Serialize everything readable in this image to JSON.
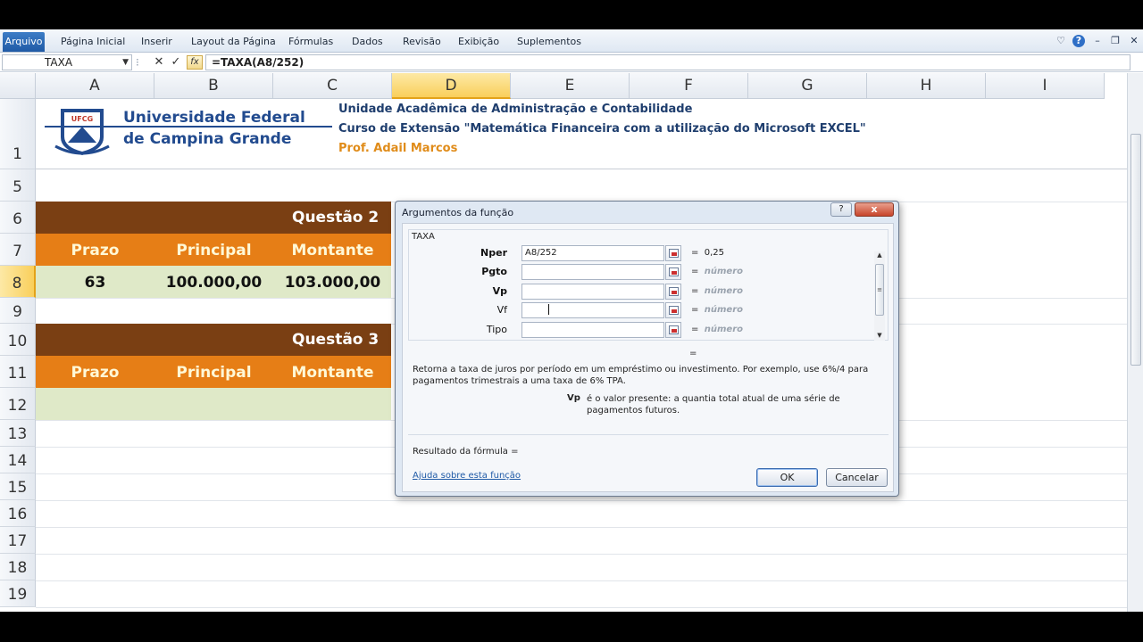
{
  "ribbon": {
    "file_tab": "Arquivo",
    "tabs": [
      "Página Inicial",
      "Inserir",
      "Layout da Página",
      "Fórmulas",
      "Dados",
      "Revisão",
      "Exibição",
      "Suplementos"
    ]
  },
  "formula_bar": {
    "name_box": "TAXA",
    "fx_label": "fx",
    "formula": "=TAXA(A8/252)"
  },
  "columns": [
    "A",
    "B",
    "C",
    "D",
    "E",
    "F",
    "G",
    "H",
    "I"
  ],
  "rows": [
    "1",
    "5",
    "6",
    "7",
    "8",
    "9",
    "10",
    "11",
    "12",
    "13",
    "14",
    "15",
    "16",
    "17",
    "18",
    "19"
  ],
  "banner": {
    "logo_text": "UFCG",
    "university_line1": "Universidade Federal",
    "university_line2": "de Campina Grande",
    "institute_line1": "Unidade Acadêmica de Administração e Contabilidade",
    "institute_line2": "Curso de Extensão \"Matemática Financeira com a utilização do Microsoft EXCEL\"",
    "institute_line3": "Prof. Adail Marcos"
  },
  "question2": {
    "title": "Questão 2",
    "headers": [
      "Prazo",
      "Principal",
      "Montante"
    ],
    "values": [
      "63",
      "100.000,00",
      "103.000,00"
    ]
  },
  "question3": {
    "title": "Questão 3",
    "headers": [
      "Prazo",
      "Principal",
      "Montante"
    ]
  },
  "dialog": {
    "title": "Argumentos da função",
    "help_label": "?",
    "close_label": "x",
    "function_name": "TAXA",
    "args": [
      {
        "label": "Nper",
        "value": "A8/252",
        "result": "0,25"
      },
      {
        "label": "Pgto",
        "value": "",
        "result": "número"
      },
      {
        "label": "Vp",
        "value": "",
        "result": "número"
      },
      {
        "label": "Vf",
        "value": "",
        "result": "número"
      },
      {
        "label": "Tipo",
        "value": "",
        "result": "número"
      }
    ],
    "equals": "=",
    "description": "Retorna a taxa de juros por período em um empréstimo ou investimento. Por exemplo, use 6%/4 para pagamentos trimestrais a uma taxa de 6% TPA.",
    "arg_desc_name": "Vp",
    "arg_desc_text": "é o valor presente: a quantia total atual de uma série de pagamentos futuros.",
    "result_label": "Resultado da fórmula =",
    "help_link": "Ajuda sobre esta função",
    "ok_label": "OK",
    "cancel_label": "Cancelar"
  },
  "colors": {
    "brown": "#7a3f13",
    "orange": "#e67e16",
    "green": "#dfe9c8",
    "blue_text": "#224b8f"
  }
}
